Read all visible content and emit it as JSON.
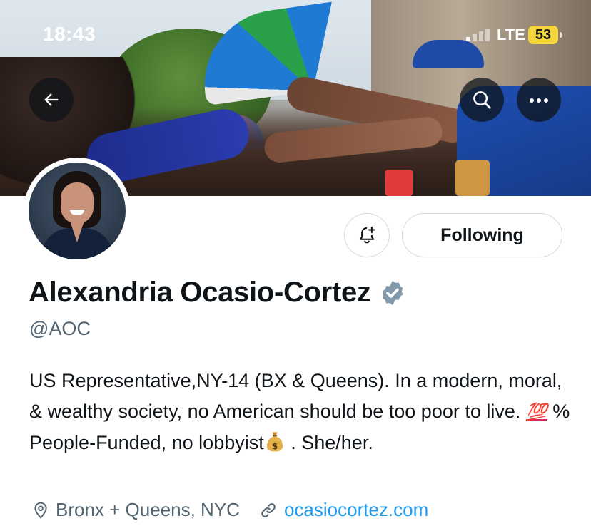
{
  "status_bar": {
    "time": "18:43",
    "network": "LTE",
    "battery": "53"
  },
  "banner": {
    "back_icon": "arrow-left-icon",
    "search_icon": "search-icon",
    "more_icon": "more-horizontal-icon"
  },
  "actions": {
    "notifications_icon": "bell-plus-icon",
    "following_label": "Following"
  },
  "profile": {
    "name": "Alexandria Ocasio-Cortez",
    "verified_icon": "verified-badge-icon",
    "handle": "@AOC",
    "bio_part1": "US Representative,NY-14 (BX & Queens). In a modern, moral, & wealthy society, no American should be too poor to live. ",
    "bio_emoji_100": "💯",
    "bio_part2": " % People-Funded, no lobbyist",
    "bio_emoji_bag_icon": "money-bag-icon",
    "bio_part3": " . She/her.",
    "location": "Bronx + Queens, NYC",
    "location_icon": "location-pin-icon",
    "website": "ocasiocortez.com",
    "website_icon": "link-icon"
  },
  "colors": {
    "text_primary": "#0f1419",
    "text_secondary": "#536471",
    "link": "#1d9bf0",
    "verified": "#829aab",
    "battery": "#f5d53c"
  }
}
